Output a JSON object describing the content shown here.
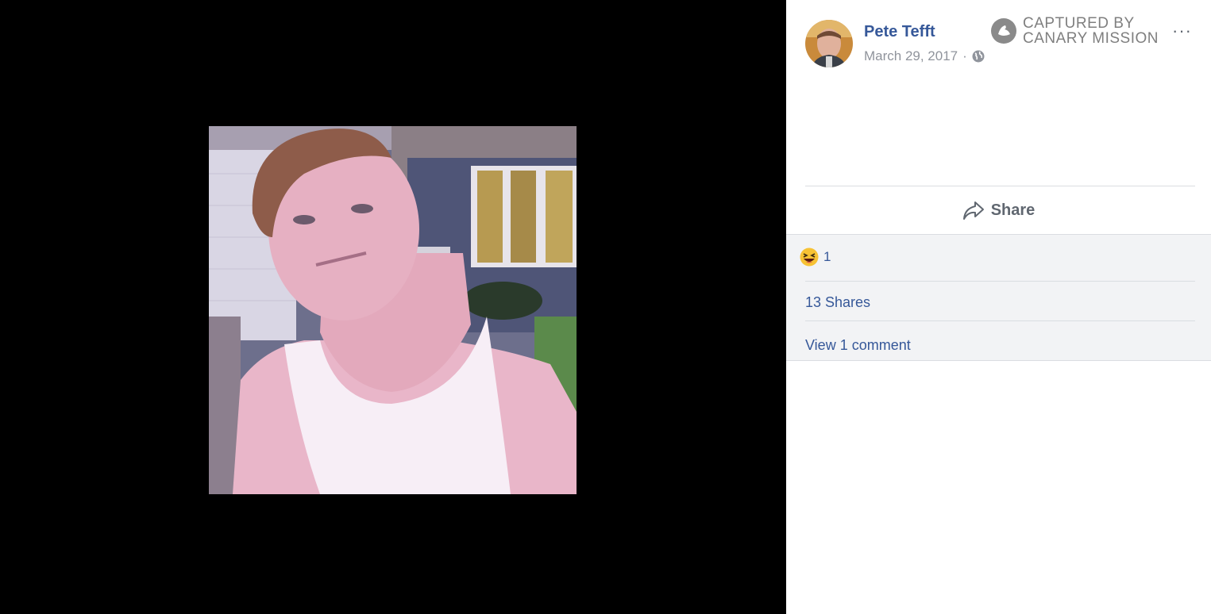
{
  "post": {
    "author": "Pete Tefft",
    "date": "March 29, 2017",
    "date_separator": "·",
    "privacy_icon": "globe-icon",
    "more_label": "···"
  },
  "watermark": {
    "line1": "CAPTURED BY",
    "line2": "CANARY MISSION",
    "icon": "canary-logo-icon"
  },
  "actions": {
    "share_label": "Share",
    "share_icon": "share-arrow-icon"
  },
  "stats": {
    "reaction_icon": "haha-emoji-icon",
    "reaction_count": "1",
    "shares_label": "13 Shares",
    "comments_label": "View 1 comment"
  },
  "colors": {
    "link_blue": "#365899",
    "muted_gray": "#90949c",
    "panel_bg": "#f2f3f5"
  }
}
